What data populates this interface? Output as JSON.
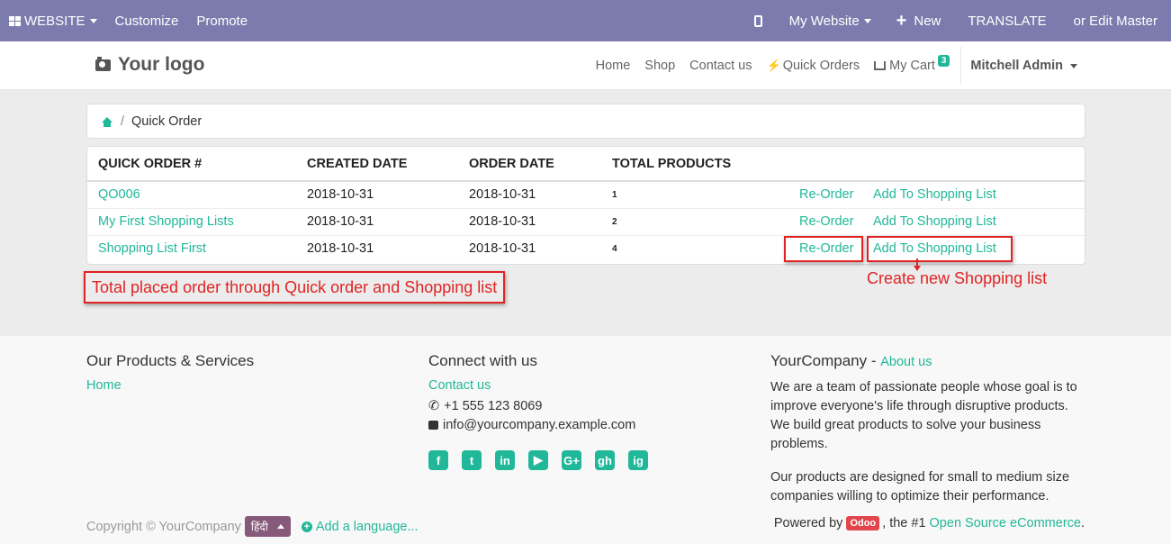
{
  "adminbar": {
    "website": "WEBSITE",
    "customize": "Customize",
    "promote": "Promote",
    "my_website": "My Website",
    "new": "New",
    "translate": "TRANSLATE",
    "edit_master": "or Edit Master"
  },
  "header": {
    "logo": "Your logo",
    "nav": [
      "Home",
      "Shop",
      "Contact us",
      "Quick Orders",
      "My Cart"
    ],
    "cart_count": "3",
    "user": "Mitchell Admin"
  },
  "breadcrumb": {
    "sep": "/",
    "current": "Quick Order"
  },
  "table": {
    "headers": [
      "Quick Order #",
      "Created Date",
      "Order Date",
      "Total Products"
    ],
    "rows": [
      {
        "name": "QO006",
        "created": "2018-10-31",
        "ordered": "2018-10-31",
        "total": "1",
        "reorder": "Re-Order",
        "add": "Add To Shopping List"
      },
      {
        "name": "My First Shopping Lists",
        "created": "2018-10-31",
        "ordered": "2018-10-31",
        "total": "2",
        "reorder": "Re-Order",
        "add": "Add To Shopping List"
      },
      {
        "name": "Shopping List First",
        "created": "2018-10-31",
        "ordered": "2018-10-31",
        "total": "4",
        "reorder": "Re-Order",
        "add": "Add To Shopping List"
      }
    ]
  },
  "annotations": {
    "total_placed": "Total placed order through Quick order and Shopping list",
    "create_new": "Create new Shopping list"
  },
  "footer": {
    "col1": {
      "title": "Our Products & Services",
      "link": "Home"
    },
    "col2": {
      "title": "Connect with us",
      "contact": "Contact us",
      "phone": "+1 555 123 8069",
      "email": "info@yourcompany.example.com"
    },
    "col3": {
      "title": "YourCompany",
      "title_sep": "-",
      "about": "About us",
      "p1": "We are a team of passionate people whose goal is to improve everyone's life through disruptive products. We build great products to solve your business problems.",
      "p2": "Our products are designed for small to medium size companies willing to optimize their performance."
    },
    "social": [
      "f",
      "t",
      "in",
      "▶",
      "G+",
      "gh",
      "ig"
    ],
    "copyright": "Copyright © YourCompany",
    "language": "हिंदी",
    "add_language": "Add a language...",
    "powered_prefix": "Powered by",
    "odoo": "Odoo",
    "powered_mid": ", the #1",
    "powered_link": "Open Source eCommerce",
    "powered_end": "."
  },
  "colors": {
    "adminbar": "#7c7bad",
    "accent": "#21b799",
    "annotation": "#e02424"
  }
}
